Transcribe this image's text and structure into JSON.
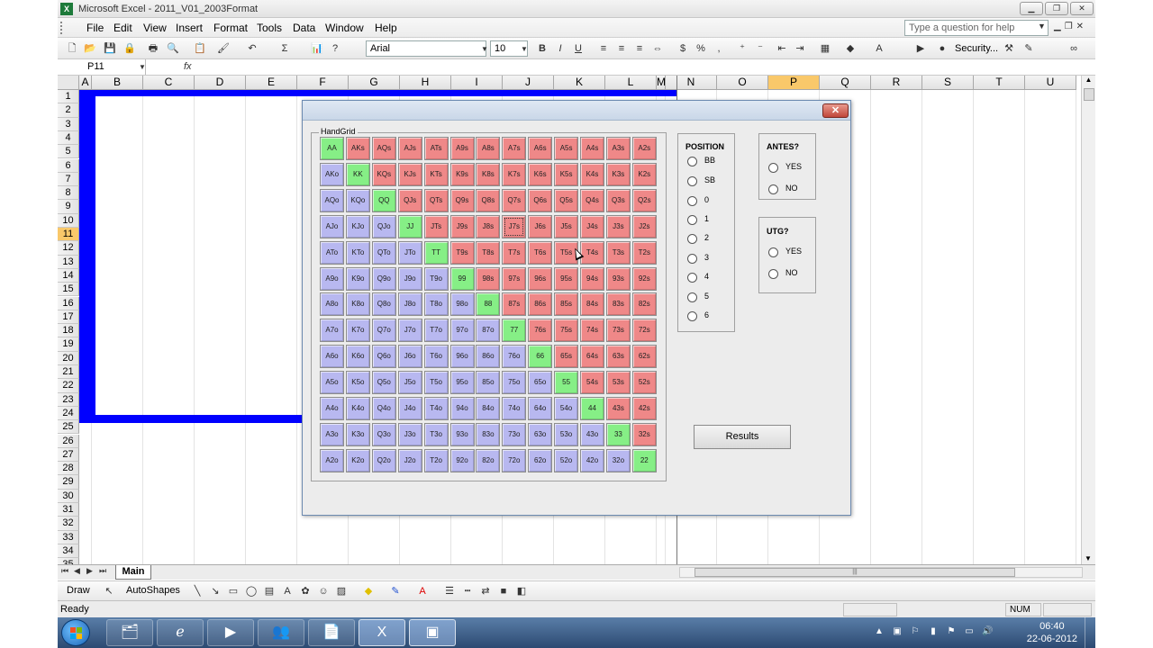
{
  "window": {
    "title": "Microsoft Excel - 2011_V01_2003Format",
    "app_icon": "excel-icon"
  },
  "menu": {
    "items": [
      "File",
      "Edit",
      "View",
      "Insert",
      "Format",
      "Tools",
      "Data",
      "Window",
      "Help"
    ],
    "help_placeholder": "Type a question for help"
  },
  "toolbar": {
    "font": "Arial",
    "size": "10",
    "security_label": "Security..."
  },
  "formula_bar": {
    "name_box": "P11",
    "fx": "fx",
    "content": ""
  },
  "sheet": {
    "columns": [
      "A",
      "B",
      "C",
      "D",
      "E",
      "F",
      "G",
      "H",
      "I",
      "J",
      "K",
      "L",
      "M",
      "N",
      "O",
      "P",
      "Q",
      "R",
      "S",
      "T",
      "U"
    ],
    "selected_column": "P",
    "rows": [
      "1",
      "2",
      "3",
      "4",
      "5",
      "6",
      "7",
      "8",
      "9",
      "10",
      "11",
      "12",
      "13",
      "14",
      "15",
      "16",
      "17",
      "18",
      "19",
      "20",
      "21",
      "22",
      "23",
      "24",
      "25",
      "26",
      "27",
      "28",
      "29",
      "30",
      "31",
      "32",
      "33",
      "34",
      "35"
    ],
    "selected_row": "11",
    "tab": "Main"
  },
  "drawing_toolbar": {
    "draw_label": "Draw",
    "autoshapes_label": "AutoShapes"
  },
  "status": {
    "ready": "Ready",
    "num": "NUM"
  },
  "dialog": {
    "close_label": "✕",
    "handgrid_caption": "HandGrid",
    "grid": [
      [
        "AA",
        "AKs",
        "AQs",
        "AJs",
        "ATs",
        "A9s",
        "A8s",
        "A7s",
        "A6s",
        "A5s",
        "A4s",
        "A3s",
        "A2s"
      ],
      [
        "AKo",
        "KK",
        "KQs",
        "KJs",
        "KTs",
        "K9s",
        "K8s",
        "K7s",
        "K6s",
        "K5s",
        "K4s",
        "K3s",
        "K2s"
      ],
      [
        "AQo",
        "KQo",
        "QQ",
        "QJs",
        "QTs",
        "Q9s",
        "Q8s",
        "Q7s",
        "Q6s",
        "Q5s",
        "Q4s",
        "Q3s",
        "Q2s"
      ],
      [
        "AJo",
        "KJo",
        "QJo",
        "JJ",
        "JTs",
        "J9s",
        "J8s",
        "J7s",
        "J6s",
        "J5s",
        "J4s",
        "J3s",
        "J2s"
      ],
      [
        "ATo",
        "KTo",
        "QTo",
        "JTo",
        "TT",
        "T9s",
        "T8s",
        "T7s",
        "T6s",
        "T5s",
        "T4s",
        "T3s",
        "T2s"
      ],
      [
        "A9o",
        "K9o",
        "Q9o",
        "J9o",
        "T9o",
        "99",
        "98s",
        "97s",
        "96s",
        "95s",
        "94s",
        "93s",
        "92s"
      ],
      [
        "A8o",
        "K8o",
        "Q8o",
        "J8o",
        "T8o",
        "98o",
        "88",
        "87s",
        "86s",
        "85s",
        "84s",
        "83s",
        "82s"
      ],
      [
        "A7o",
        "K7o",
        "Q7o",
        "J7o",
        "T7o",
        "97o",
        "87o",
        "77",
        "76s",
        "75s",
        "74s",
        "73s",
        "72s"
      ],
      [
        "A6o",
        "K6o",
        "Q6o",
        "J6o",
        "T6o",
        "96o",
        "86o",
        "76o",
        "66",
        "65s",
        "64s",
        "63s",
        "62s"
      ],
      [
        "A5o",
        "K5o",
        "Q5o",
        "J5o",
        "T5o",
        "95o",
        "85o",
        "75o",
        "65o",
        "55",
        "54s",
        "53s",
        "52s"
      ],
      [
        "A4o",
        "K4o",
        "Q4o",
        "J4o",
        "T4o",
        "94o",
        "84o",
        "74o",
        "64o",
        "54o",
        "44",
        "43s",
        "42s"
      ],
      [
        "A3o",
        "K3o",
        "Q3o",
        "J3o",
        "T3o",
        "93o",
        "83o",
        "73o",
        "63o",
        "53o",
        "43o",
        "33",
        "32s"
      ],
      [
        "A2o",
        "K2o",
        "Q2o",
        "J2o",
        "T2o",
        "92o",
        "82o",
        "72o",
        "62o",
        "52o",
        "42o",
        "32o",
        "22"
      ]
    ],
    "focused_cell": "J7s",
    "colors": {
      "pair": "#86ef86",
      "suited": "#ef8888",
      "offsuit": "#b8b8f0"
    },
    "position": {
      "title": "POSITION",
      "options": [
        "BB",
        "SB",
        "0",
        "1",
        "2",
        "3",
        "4",
        "5",
        "6"
      ]
    },
    "antes": {
      "title": "ANTES?",
      "options": [
        "YES",
        "NO"
      ]
    },
    "utg": {
      "title": "UTG?",
      "options": [
        "YES",
        "NO"
      ]
    },
    "results_label": "Results"
  },
  "taskbar": {
    "time": "06:40",
    "date": "22-06-2012",
    "apps": [
      "explorer-icon",
      "internet-explorer-icon",
      "media-player-icon",
      "messenger-icon",
      "notepad-icon",
      "excel-icon",
      "vba-editor-icon"
    ]
  }
}
